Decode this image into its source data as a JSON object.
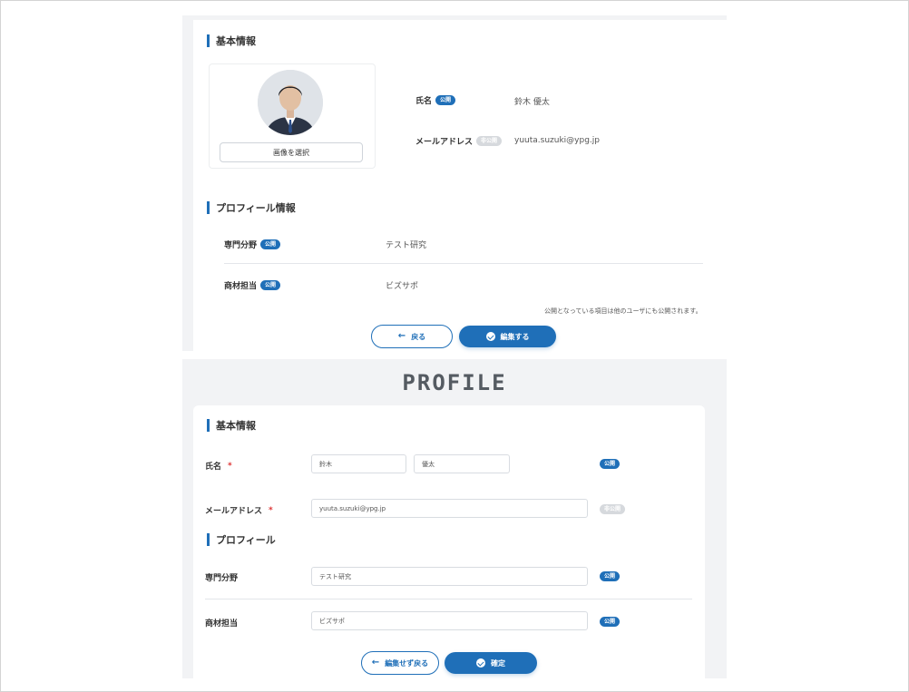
{
  "view": {
    "section_basic": "基本情報",
    "section_profile": "プロフィール情報",
    "select_image_button": "画像を選択",
    "name_label": "氏名",
    "name_badge": "公開",
    "name_value": "鈴木 優太",
    "email_label": "メールアドレス",
    "email_badge": "非公開",
    "email_value": "yuuta.suzuki@ypg.jp",
    "specialty_label": "専門分野",
    "specialty_badge": "公開",
    "specialty_value": "テスト研究",
    "material_label": "商材担当",
    "material_badge": "公開",
    "material_value": "ビズサポ",
    "note": "公開となっている項目は他のユーザにも公開されます。",
    "back_button": "戻る",
    "edit_button": "編集する"
  },
  "edit": {
    "page_title": "PROFILE",
    "section_basic": "基本情報",
    "name_label": "氏名",
    "required_mark": "*",
    "last_name_value": "鈴木",
    "first_name_value": "優太",
    "name_badge": "公開",
    "email_label": "メールアドレス",
    "email_value": "yuuta.suzuki@ypg.jp",
    "email_badge": "非公開",
    "section_profile": "プロフィール",
    "specialty_label": "専門分野",
    "specialty_value": "テスト研究",
    "specialty_badge": "公開",
    "material_label": "商材担当",
    "material_value": "ビズサポ",
    "material_badge": "公開",
    "back_button": "編集せず戻る",
    "confirm_button": "確定"
  },
  "colors": {
    "accent": "#1f6fb8",
    "private_badge": "#d6d9dd",
    "panel_bg": "#f2f3f5"
  },
  "icons": [
    "avatar-photo",
    "arrow-left-icon",
    "check-circle-icon"
  ]
}
